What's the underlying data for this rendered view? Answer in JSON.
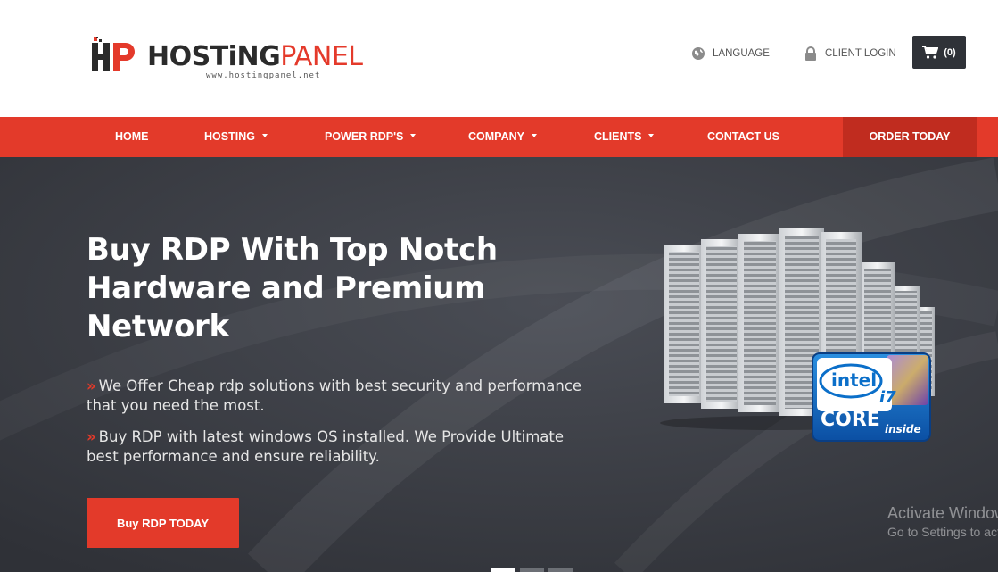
{
  "header": {
    "logo": {
      "brand_dark": "HOSTiNG",
      "brand_red": "PANEL",
      "url": "www.hostingpanel.net"
    },
    "language_label": "LANGUAGE",
    "login_label": "CLIENT LOGIN",
    "cart_label": "(0)"
  },
  "nav": {
    "items": [
      {
        "label": "HOME"
      },
      {
        "label": "HOSTING"
      },
      {
        "label": "POWER RDP'S"
      },
      {
        "label": "COMPANY"
      },
      {
        "label": "CLIENTS"
      },
      {
        "label": "CONTACT US"
      }
    ],
    "order_label": "ORDER TODAY"
  },
  "hero": {
    "title": "Buy RDP With Top Notch Hardware and Premium Network",
    "bullets": [
      "We Offer Cheap rdp solutions with best security and performance that you need the most.",
      "Buy RDP with latest windows OS installed. We Provide Ultimate best performance and ensure reliability."
    ],
    "cta_label": "Buy RDP TODAY",
    "intel": {
      "brand": "intel",
      "model": "i7",
      "line": "CORE",
      "tag": "inside"
    },
    "slider": {
      "count": 3,
      "active": 1
    }
  },
  "watermark": {
    "line1": "Activate Windows",
    "line2": "Go to Settings to activate Windows."
  },
  "colors": {
    "accent": "#e33a2a",
    "accent_dark": "#c02c1f",
    "hero_bg": "#3b3e45",
    "cart_bg": "#2f3238"
  },
  "icons": {
    "language": "globe-icon",
    "login": "lock-icon",
    "cart": "cart-icon",
    "bullet": "double-chevron-icon"
  }
}
